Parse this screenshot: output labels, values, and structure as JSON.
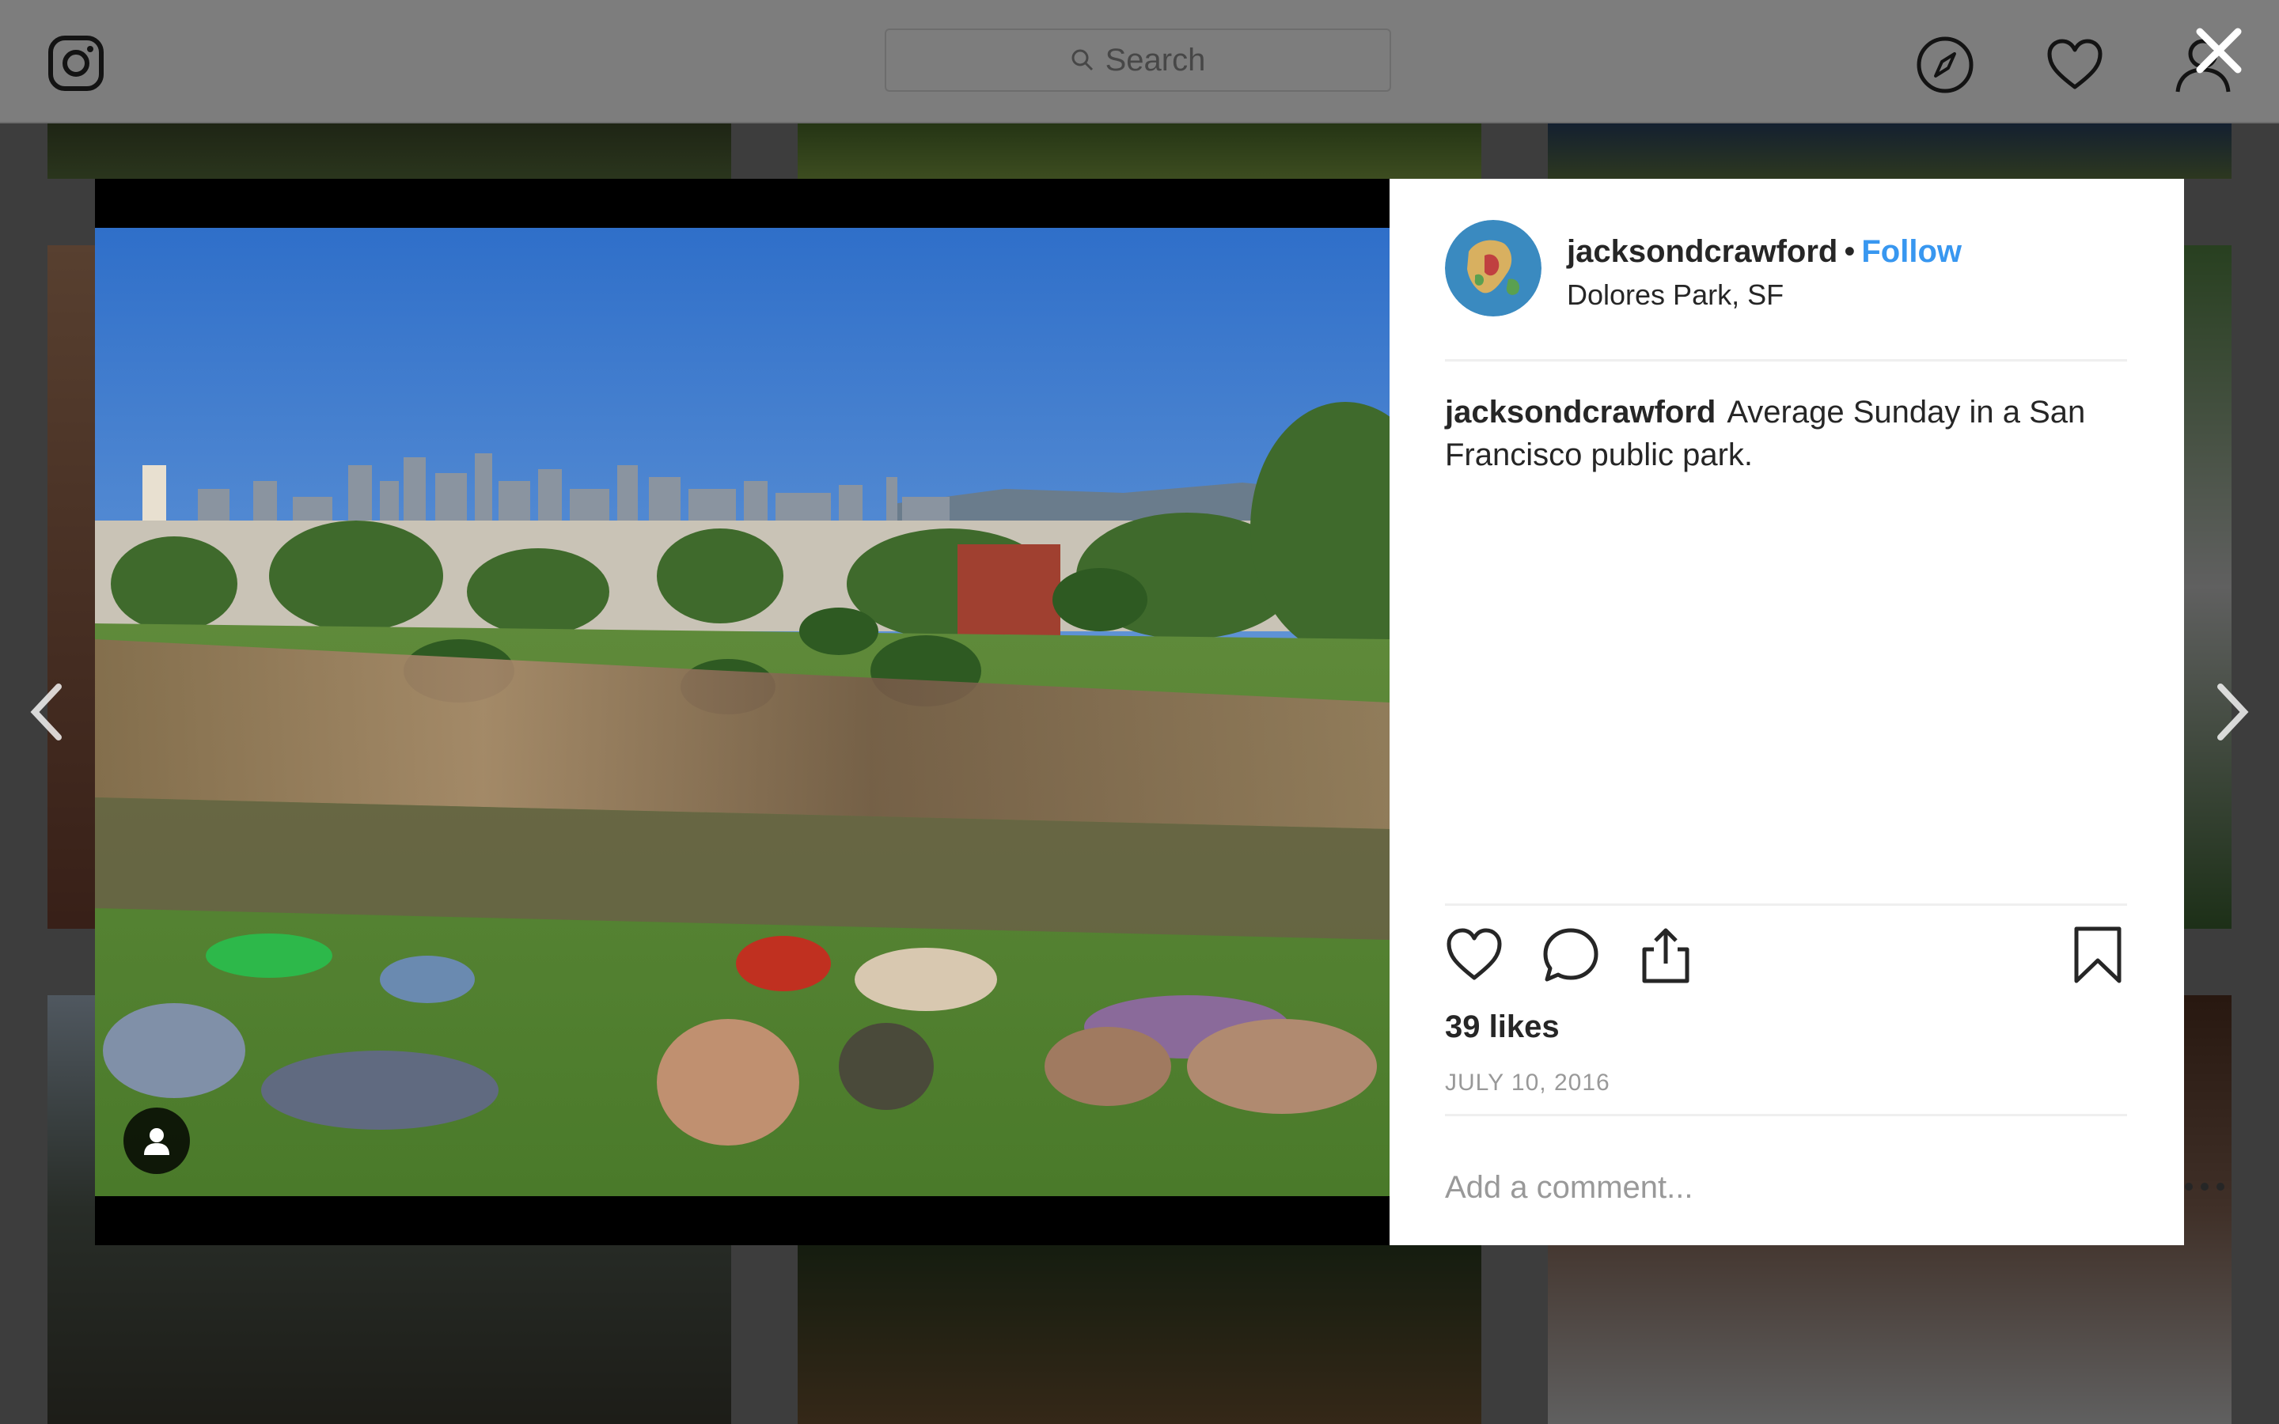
{
  "search": {
    "placeholder": "Search"
  },
  "post": {
    "username": "jacksondcrawford",
    "follow_label": "Follow",
    "separator": "•",
    "location": "Dolores Park, SF",
    "caption_username": "jacksondcrawford",
    "caption_text": "Average Sunday in a San Francisco public park.",
    "likes": "39 likes",
    "date": "JULY 10, 2016"
  },
  "comment": {
    "placeholder": "Add a comment..."
  },
  "icons": {
    "logo": "instagram-logo-icon",
    "search": "search-icon",
    "explore": "compass-icon",
    "activity": "heart-outline-icon",
    "profile": "user-outline-icon",
    "close": "close-icon",
    "prev": "chevron-left-icon",
    "next": "chevron-right-icon",
    "like": "heart-icon",
    "comment": "comment-icon",
    "share": "share-icon",
    "save": "bookmark-icon",
    "tag": "person-tag-icon",
    "more": "more-options-icon"
  },
  "colors": {
    "follow": "#3897f0",
    "overlay": "rgba(0,0,0,0.5)",
    "text": "#262626",
    "muted": "#999999"
  }
}
